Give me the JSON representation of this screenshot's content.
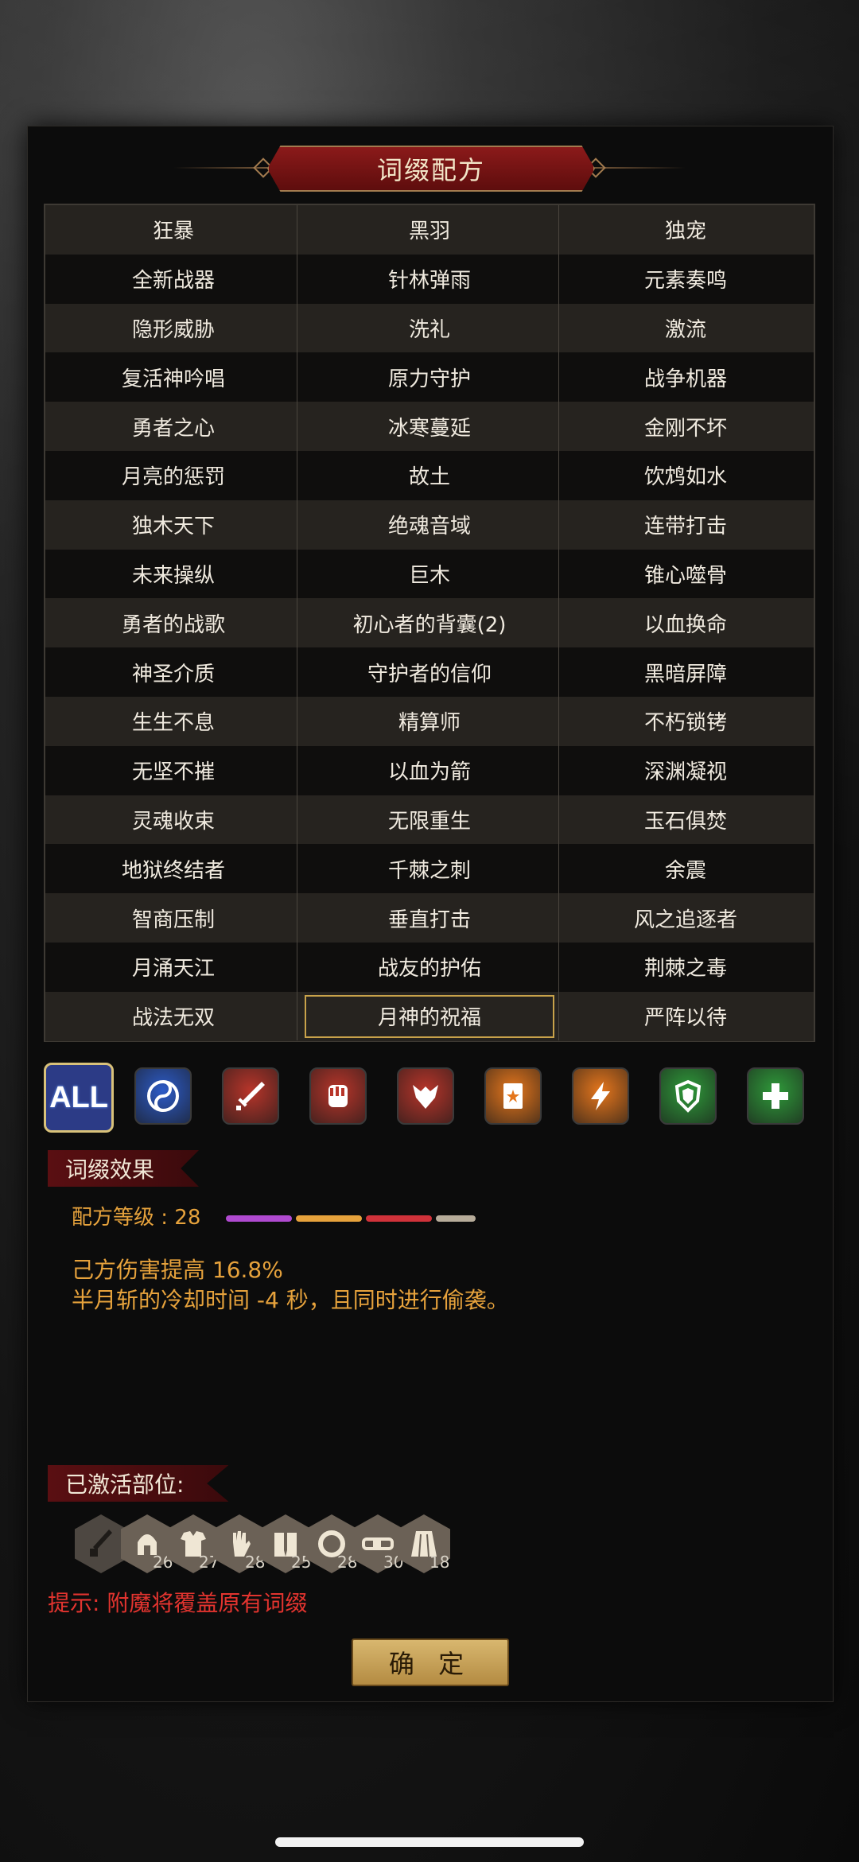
{
  "title": "词缀配方",
  "affix_table": {
    "rows": [
      [
        "狂暴",
        "黑羽",
        "独宠"
      ],
      [
        "全新战器",
        "针林弹雨",
        "元素奏鸣"
      ],
      [
        "隐形威胁",
        "洗礼",
        "激流"
      ],
      [
        "复活神吟唱",
        "原力守护",
        "战争机器"
      ],
      [
        "勇者之心",
        "冰寒蔓延",
        "金刚不坏"
      ],
      [
        "月亮的惩罚",
        "故土",
        "饮鸩如水"
      ],
      [
        "独木天下",
        "绝魂音域",
        "连带打击"
      ],
      [
        "未来操纵",
        "巨木",
        "锥心噬骨"
      ],
      [
        "勇者的战歌",
        "初心者的背囊(2)",
        "以血换命"
      ],
      [
        "神圣介质",
        "守护者的信仰",
        "黑暗屏障"
      ],
      [
        "生生不息",
        "精算师",
        "不朽锁铐"
      ],
      [
        "无坚不摧",
        "以血为箭",
        "深渊凝视"
      ],
      [
        "灵魂收束",
        "无限重生",
        "玉石俱焚"
      ],
      [
        "地狱终结者",
        "千棘之刺",
        "余震"
      ],
      [
        "智商压制",
        "垂直打击",
        "风之追逐者"
      ],
      [
        "月涌天江",
        "战友的护佑",
        "荆棘之毒"
      ],
      [
        "战法无双",
        "月神的祝福",
        "严阵以待"
      ]
    ],
    "selected": "月神的祝福"
  },
  "categories": [
    {
      "name": "all",
      "label": "ALL",
      "selected": true
    },
    {
      "name": "yin-yang-icon",
      "color": "#2d5bc7"
    },
    {
      "name": "sword-icon",
      "color": "#b8352a"
    },
    {
      "name": "fist-icon",
      "color": "#b8352a"
    },
    {
      "name": "wolf-icon",
      "color": "#b8352a"
    },
    {
      "name": "book-icon",
      "color": "#e5761c"
    },
    {
      "name": "lightning-icon",
      "color": "#e5761c"
    },
    {
      "name": "shield-icon",
      "color": "#2f9a3a"
    },
    {
      "name": "plus-icon",
      "color": "#2f9a3a"
    }
  ],
  "effect_section": {
    "heading": "词缀效果",
    "grade_label": "配方等级 : 28",
    "grade_segments": [
      {
        "color": "#b04ad0",
        "fraction": 0.33
      },
      {
        "color": "#e6a23c",
        "fraction": 0.33
      },
      {
        "color": "#d0323a",
        "fraction": 0.33
      },
      {
        "color": "#b7ac9a",
        "fraction": 0.2
      }
    ],
    "effect_lines": [
      "己方伤害提高 16.8%",
      "半月斩的冷却时间 -4 秒，且同时进行偷袭。"
    ]
  },
  "activated_section": {
    "heading": "已激活部位:",
    "slots": [
      {
        "name": "dagger-icon",
        "value": ""
      },
      {
        "name": "helmet-icon",
        "value": "26"
      },
      {
        "name": "armor-icon",
        "value": "27"
      },
      {
        "name": "glove-icon",
        "value": "28"
      },
      {
        "name": "boots-icon",
        "value": "25"
      },
      {
        "name": "ring-icon",
        "value": "28"
      },
      {
        "name": "belt-icon",
        "value": "30"
      },
      {
        "name": "skirt-icon",
        "value": "18"
      }
    ]
  },
  "hint": "提示: 附魔将覆盖原有词缀",
  "confirm_label": "确 定"
}
